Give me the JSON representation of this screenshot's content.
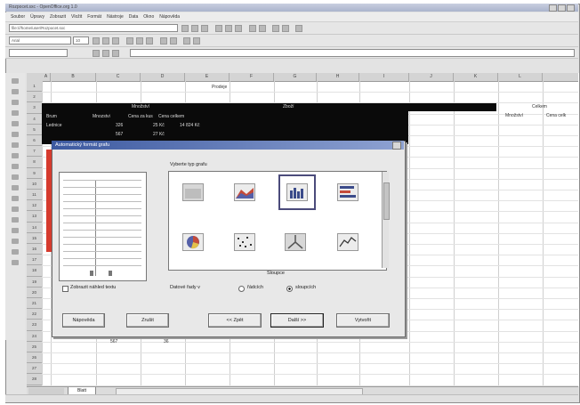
{
  "window": {
    "title": "Rozpocet.sxc - OpenOffice.org 1.0"
  },
  "menu": [
    "Soubor",
    "Úpravy",
    "Zobrazit",
    "Vložit",
    "Formát",
    "Nástroje",
    "Data",
    "Okno",
    "Nápověda"
  ],
  "toolbar": {
    "url": "file:///home/user/Rozpocet.sxc",
    "font": "Arial",
    "size": "10"
  },
  "sheet": {
    "columns": [
      "A",
      "B",
      "C",
      "D",
      "E",
      "F",
      "G",
      "H",
      "I",
      "J",
      "K",
      "L"
    ],
    "rows": [
      "1",
      "2",
      "3",
      "4",
      "5",
      "6",
      "7",
      "8",
      "9",
      "10",
      "11",
      "12",
      "13",
      "14",
      "15",
      "16",
      "17",
      "18",
      "19",
      "20",
      "21",
      "22",
      "23",
      "24",
      "25",
      "26",
      "27",
      "28"
    ],
    "title_cell": "Prodeje",
    "cells": {
      "mnozstvi_hdr": "Množství",
      "zbozi_hdr": "Zboží",
      "rh1": "Mnozstvi",
      "rh2": "Cena za kus",
      "rh3": "Cena celkem",
      "r5a": "Brum",
      "r5b": "Lednice",
      "v1": "326",
      "v2": "25 Kč",
      "v3": "14 824 Kč",
      "v4": "567",
      "v5": "27 Kč",
      "right_hdr": "Celkem",
      "right_a": "Množství",
      "right_b": "Cena celk",
      "bottom_a": "567",
      "bottom_b": "36"
    },
    "sheet_tab": "Blatt"
  },
  "dialog": {
    "title": "Automatický formát grafu",
    "gallery_label": "Vyberte typ grafu",
    "selected_caption": "Sloupce",
    "show_text_checkbox": "Zobrazit náhled textu",
    "series_label": "Datové řady v",
    "radio_rows": "řádcích",
    "radio_cols": "sloupcích",
    "buttons": {
      "help": "Nápověda",
      "cancel": "Zrušit",
      "back": "<< Zpět",
      "next": "Další >>",
      "create": "Vytvořit"
    },
    "chart_types": [
      "area-chart-icon",
      "area-3d-chart-icon",
      "column-chart-icon",
      "bar-chart-icon",
      "pie-chart-icon",
      "xy-scatter-chart-icon",
      "net-chart-icon",
      "line-chart-icon"
    ]
  },
  "colors": {
    "accent": "#3c59a0",
    "selection": "#0a0a0a",
    "red_marker": "#d63b2e"
  }
}
